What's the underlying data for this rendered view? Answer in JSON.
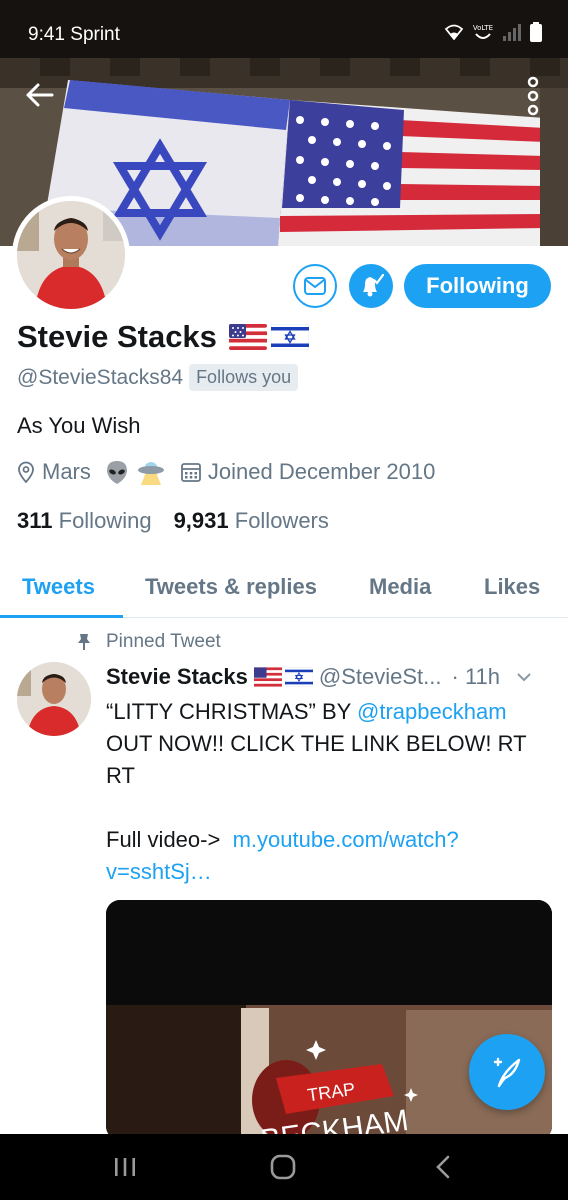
{
  "status_bar": {
    "time": "9:41",
    "carrier": "Sprint",
    "icons": [
      "wifi-icon",
      "volte-icon",
      "signal-icon",
      "battery-icon"
    ],
    "volte_label": "VoLTE"
  },
  "header": {
    "back_icon": "arrow-left-icon",
    "more_icon": "more-vertical-icon",
    "banner": "Israeli and American flags projected onto a stone wall"
  },
  "profile": {
    "display_name": "Stevie Stacks",
    "name_emoji": [
      "us-flag-icon",
      "israel-flag-icon"
    ],
    "handle": "@StevieStacks84",
    "follows_you": "Follows you",
    "bio": "As You Wish",
    "location": "Mars",
    "location_emoji": [
      "alien-icon",
      "ufo-icon"
    ],
    "joined": "Joined December 2010",
    "following_count": "311",
    "following_label": "Following",
    "followers_count": "9,931",
    "followers_label": "Followers"
  },
  "actions": {
    "message_icon": "envelope-icon",
    "notify_icon": "bell-check-icon",
    "following_button": "Following"
  },
  "tabs": [
    {
      "label": "Tweets",
      "active": true
    },
    {
      "label": "Tweets & replies",
      "active": false
    },
    {
      "label": "Media",
      "active": false
    },
    {
      "label": "Likes",
      "active": false
    }
  ],
  "pinned_tweet": {
    "pinned_label": "Pinned Tweet",
    "author": "Stevie Stacks",
    "handle": "@StevieSt...",
    "separator": "·",
    "time": "11h",
    "text_line1_prefix": "“LITTY CHRISTMAS” BY ",
    "mention": "@trapbeckham",
    "text_line2": "OUT NOW!! CLICK THE LINK BELOW! RT RT",
    "text_line4_prefix": "Full video->  ",
    "link": "m.youtube.com/watch?v=sshtSj…",
    "media_text": "TRAP BECKHAM"
  },
  "fab": {
    "icon": "compose-tweet-icon"
  },
  "nav_bar": {
    "icons": [
      "recents-icon",
      "home-icon",
      "back-icon"
    ]
  },
  "colors": {
    "accent": "#1da1f2",
    "text": "#14171a",
    "secondary": "#657786"
  }
}
